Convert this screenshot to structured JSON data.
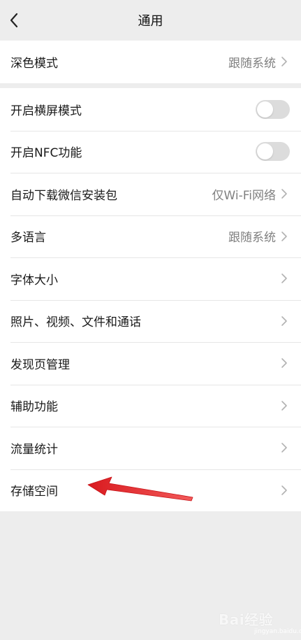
{
  "header": {
    "title": "通用"
  },
  "group1": {
    "items": [
      {
        "label": "深色模式",
        "value": "跟随系统"
      }
    ]
  },
  "group2": {
    "items": [
      {
        "label": "开启横屏模式",
        "toggle": false
      },
      {
        "label": "开启NFC功能",
        "toggle": false
      },
      {
        "label": "自动下载微信安装包",
        "value": "仅Wi-Fi网络"
      },
      {
        "label": "多语言",
        "value": "跟随系统"
      },
      {
        "label": "字体大小"
      },
      {
        "label": "照片、视频、文件和通话"
      },
      {
        "label": "发现页管理"
      },
      {
        "label": "辅助功能"
      },
      {
        "label": "流量统计"
      },
      {
        "label": "存储空间"
      }
    ]
  },
  "watermark": {
    "brand": "Bai经验",
    "url": "jingyan.baidu.com"
  },
  "colors": {
    "background": "#ededed",
    "row_background": "#ffffff",
    "secondary_text": "#808080",
    "toggle_off": "#dcdcdc",
    "annotation_arrow": "#e8262a"
  }
}
